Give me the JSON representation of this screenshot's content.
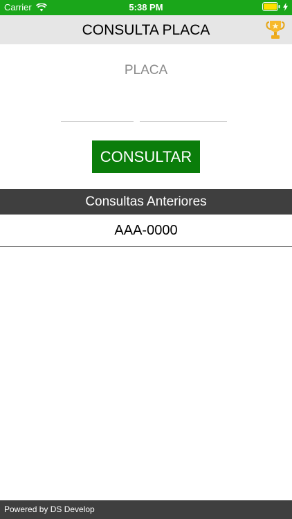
{
  "status_bar": {
    "carrier": "Carrier",
    "time": "5:38 PM"
  },
  "nav": {
    "title": "CONSULTA PLACA",
    "trophy_icon": "trophy-icon"
  },
  "form": {
    "label": "PLACA",
    "letters_value": "",
    "numbers_value": "",
    "button_label": "CONSULTAR"
  },
  "history": {
    "header": "Consultas Anteriores",
    "items": [
      "AAA-0000"
    ]
  },
  "footer": {
    "text": "Powered by DS Develop"
  },
  "colors": {
    "status_bar": "#1aa61a",
    "button": "#0a7d0a",
    "dark_bar": "#3f3f3f",
    "nav_bar": "#e6e6e6"
  }
}
